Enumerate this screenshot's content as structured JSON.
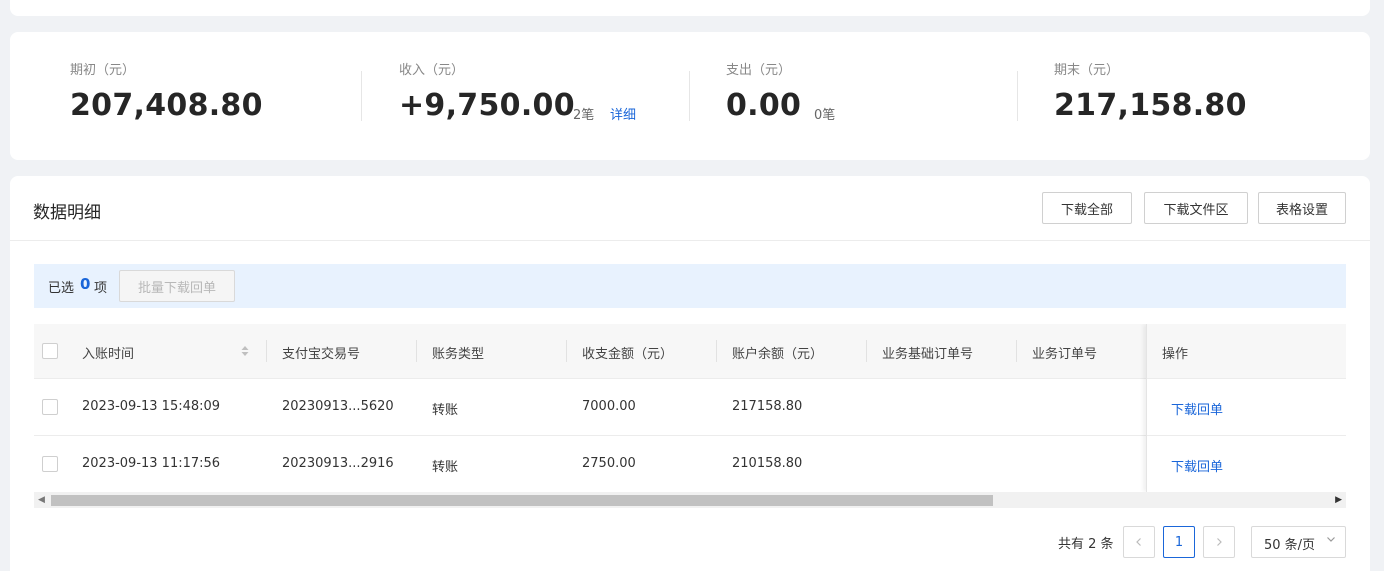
{
  "summary": {
    "opening": {
      "label": "期初（元）",
      "value": "207,408.80"
    },
    "income": {
      "label": "收入（元）",
      "value": "+9,750.00",
      "count": "2笔",
      "link": "详细"
    },
    "expense": {
      "label": "支出（元）",
      "value": "0.00",
      "count": "0笔"
    },
    "closing": {
      "label": "期末（元）",
      "value": "217,158.80"
    }
  },
  "detail": {
    "title": "数据明细",
    "buttons": {
      "download_all": "下载全部",
      "download_files": "下载文件区",
      "table_settings": "表格设置"
    }
  },
  "selection": {
    "prefix": "已选",
    "count": "0",
    "suffix": "项",
    "batch_button": "批量下载回单"
  },
  "table": {
    "columns": [
      "入账时间",
      "支付宝交易号",
      "账务类型",
      "收支金额（元）",
      "账户余额（元）",
      "业务基础订单号",
      "业务订单号",
      "操作"
    ],
    "rows": [
      {
        "time": "2023-09-13 15:48:09",
        "trade_no": "20230913...5620",
        "type": "转账",
        "amount": "7000.00",
        "balance": "217158.80",
        "action": "下载回单"
      },
      {
        "time": "2023-09-13 11:17:56",
        "trade_no": "20230913...2916",
        "type": "转账",
        "amount": "2750.00",
        "balance": "210158.80",
        "action": "下载回单"
      }
    ]
  },
  "pagination": {
    "total": "共有 2 条",
    "current_page": "1",
    "page_size": "50 条/页"
  },
  "colors": {
    "accent": "#1a66d9",
    "selection_bar": "#e8f2fe",
    "page_bg": "#f0f2f5"
  }
}
